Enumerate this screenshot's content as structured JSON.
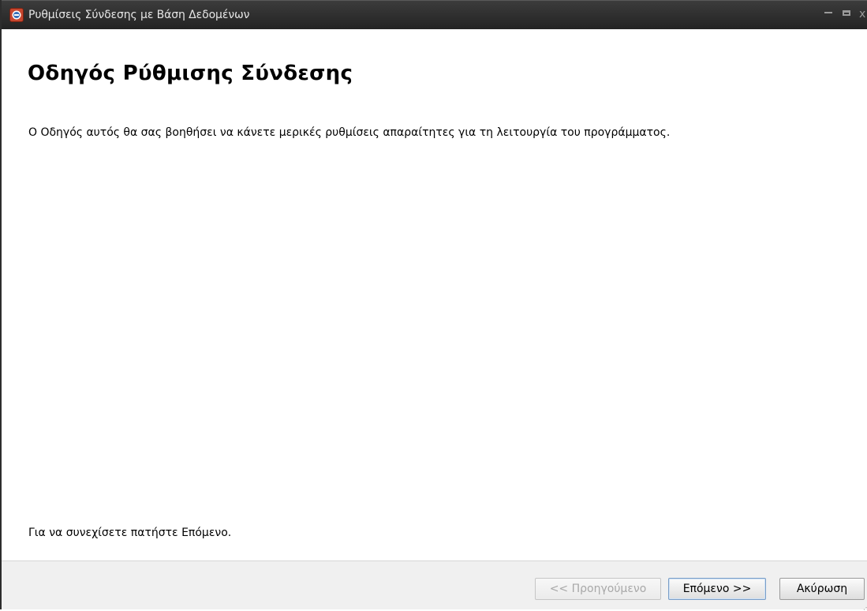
{
  "window": {
    "title": "Ρυθμίσεις Σύνδεσης με Βάση Δεδομένων",
    "controls": {
      "minimize_icon": "minimize-icon",
      "maximize_icon": "maximize-icon",
      "close_label": "x"
    },
    "app_icon": "app-icon"
  },
  "content": {
    "heading": "Οδηγός Ρύθμισης Σύνδεσης",
    "intro": "Ο Οδηγός αυτός θα σας βοηθήσει να κάνετε μερικές ρυθμίσεις απαραίτητες για τη λειτουργία του προγράμματος.",
    "continue_hint": "Για να συνεχίσετε πατήστε Επόμενο."
  },
  "buttons": {
    "previous": "<< Προηγούμενο",
    "next": "Επόμενο >>",
    "cancel": "Ακύρωση"
  },
  "colors": {
    "titlebar": "#2e2e2e",
    "footer": "#f0f0f0",
    "app_icon": "#c8472f"
  }
}
